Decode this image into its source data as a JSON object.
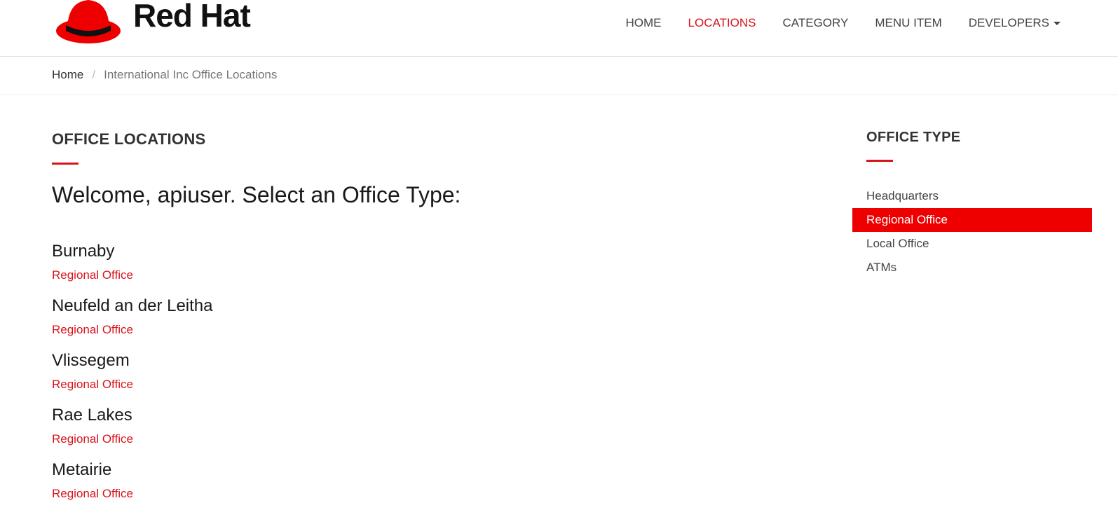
{
  "header": {
    "brand": "Red Hat",
    "nav": [
      {
        "label": "HOME",
        "active": false
      },
      {
        "label": "LOCATIONS",
        "active": true
      },
      {
        "label": "CATEGORY",
        "active": false
      },
      {
        "label": "MENU ITEM",
        "active": false
      },
      {
        "label": "DEVELOPERS",
        "active": false
      }
    ]
  },
  "breadcrumb": {
    "home": "Home",
    "separator": "/",
    "current": "International Inc Office Locations"
  },
  "main": {
    "section_title": "OFFICE LOCATIONS",
    "welcome": "Welcome, apiuser. Select an Office Type:",
    "locations": [
      {
        "name": "Burnaby",
        "type": "Regional Office"
      },
      {
        "name": "Neufeld an der Leitha",
        "type": "Regional Office"
      },
      {
        "name": "Vlissegem",
        "type": "Regional Office"
      },
      {
        "name": "Rae Lakes",
        "type": "Regional Office"
      },
      {
        "name": "Metairie",
        "type": "Regional Office"
      }
    ]
  },
  "sidebar": {
    "title": "OFFICE TYPE",
    "items": [
      {
        "label": "Headquarters",
        "selected": false
      },
      {
        "label": "Regional Office",
        "selected": true
      },
      {
        "label": "Local Office",
        "selected": false
      },
      {
        "label": "ATMs",
        "selected": false
      }
    ]
  },
  "colors": {
    "accent": "#d8141b",
    "selected_bg": "#ee0000"
  },
  "icons": {
    "logo": "redhat-fedora-icon",
    "dropdown": "caret-down-icon"
  }
}
